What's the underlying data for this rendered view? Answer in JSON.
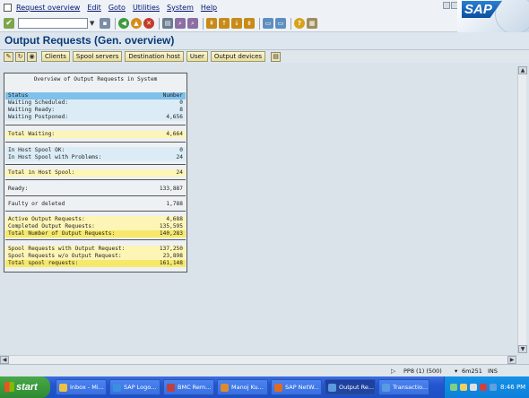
{
  "menu": {
    "items": [
      "Request overview",
      "Edit",
      "Goto",
      "Utilities",
      "System",
      "Help"
    ]
  },
  "brand": {
    "logo_text": "SAP"
  },
  "toolbar": {
    "command_field_value": "",
    "icons": [
      "ok-icon",
      "back-icon",
      "exit-icon",
      "cancel-icon",
      "print-icon",
      "find-icon",
      "find-next-icon",
      "first-page-icon",
      "prev-page-icon",
      "next-page-icon",
      "last-page-icon",
      "new-session-icon",
      "shortcut-icon",
      "help-icon",
      "customize-icon"
    ]
  },
  "title": "Output Requests (Gen. overview)",
  "app_toolbar": {
    "buttons": [
      "Clients",
      "Spool servers",
      "Destination host",
      "User",
      "Output devices"
    ],
    "icons": [
      "edit-icon",
      "refresh-icon",
      "display-icon",
      "print-icon"
    ]
  },
  "overview": {
    "title": "Overview of Output Requests in System",
    "header": {
      "label": "Status",
      "value": "Number"
    },
    "rows": [
      {
        "label": "Waiting Scheduled:",
        "value": "0"
      },
      {
        "label": "Waiting Ready:",
        "value": "8"
      },
      {
        "label": "Waiting Postponed:",
        "value": "4,656"
      },
      {
        "label": "Total Waiting:",
        "value": "4,664"
      },
      {
        "label": "In Host Spool OK:",
        "value": "0"
      },
      {
        "label": "In Host Spool with Problems:",
        "value": "24"
      },
      {
        "label": "Total in Host Spool:",
        "value": "24"
      },
      {
        "label": "Ready:",
        "value": "133,887"
      },
      {
        "label": "Faulty or deleted",
        "value": "1,788"
      },
      {
        "label": "Active Output Requests:",
        "value": "4,688"
      },
      {
        "label": "Completed Output Requests:",
        "value": "135,595"
      },
      {
        "label": "Total Number of Output Requests:",
        "value": "140,283"
      },
      {
        "label": "Spool Requests with Output Request:",
        "value": "137,250"
      },
      {
        "label": "Spool Requests w/o Output Request:",
        "value": "23,898"
      },
      {
        "label": "Total spool requests:",
        "value": "161,148"
      }
    ]
  },
  "statusbar": {
    "system": "PP8 (1) (500)",
    "server": "6m251",
    "mode": "INS"
  },
  "taskbar": {
    "start_label": "start",
    "tasks": [
      "Inbox - Mi...",
      "SAP Logo...",
      "BMC Rem...",
      "Manoj Ku...",
      "SAP NetW...",
      "Output Re...",
      "Transactio..."
    ],
    "clock": "8:46 PM"
  },
  "colors": {
    "header_row": "#7fc1ea",
    "blue_row": "#dbecf6",
    "yellow_row": "#fdf5b6",
    "total_row": "#f6e86a",
    "title_text": "#0a3a78"
  }
}
